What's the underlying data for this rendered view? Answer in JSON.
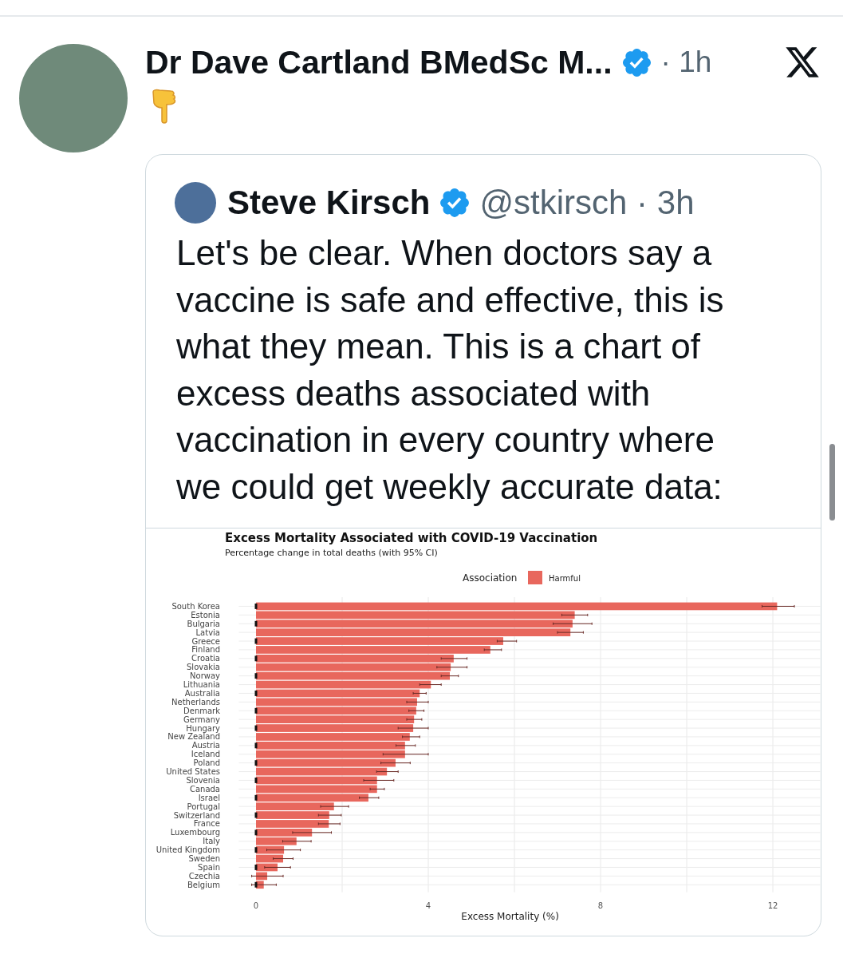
{
  "post": {
    "author": "Dr Dave Cartland BMedSc M...",
    "verified": true,
    "time": "· 1h"
  },
  "quoted_post": {
    "author": "Steve Kirsch",
    "verified": true,
    "handle": "@stkirsch",
    "time": "· 3h",
    "text": "Let's be clear. When doctors say a vaccine is safe and effective, this is what they mean. This is a chart of excess deaths associated with vaccination in every country where we could get weekly accurate data:",
    "chart_data": {
      "type": "bar",
      "orientation": "horizontal",
      "title": "Excess Mortality Associated with COVID-19 Vaccination",
      "subtitle": "Percentage change in total deaths (with 95% CI)",
      "legend_title": "Association",
      "xlabel": "Excess Mortality (%)",
      "categories": [
        "South Korea",
        "Estonia",
        "Bulgaria",
        "Latvia",
        "Greece",
        "Finland",
        "Croatia",
        "Slovakia",
        "Norway",
        "Lithuania",
        "Australia",
        "Netherlands",
        "Denmark",
        "Germany",
        "Hungary",
        "New Zealand",
        "Austria",
        "Iceland",
        "Poland",
        "United States",
        "Slovenia",
        "Canada",
        "Israel",
        "Portugal",
        "Switzerland",
        "France",
        "Luxembourg",
        "Italy",
        "United Kingdom",
        "Sweden",
        "Spain",
        "Czechia",
        "Belgium"
      ],
      "series": [
        {
          "name": "Harmful",
          "color": "#e8675d",
          "values": [
            12.1,
            7.4,
            7.35,
            7.3,
            5.74,
            5.44,
            4.59,
            4.52,
            4.5,
            4.06,
            3.8,
            3.74,
            3.72,
            3.67,
            3.65,
            3.57,
            3.46,
            3.46,
            3.24,
            3.04,
            2.81,
            2.81,
            2.61,
            1.81,
            1.7,
            1.69,
            1.3,
            0.94,
            0.65,
            0.63,
            0.5,
            0.26,
            0.18
          ],
          "errors": [
            [
              11.75,
              12.5
            ],
            [
              7.1,
              7.7
            ],
            [
              6.9,
              7.8
            ],
            [
              7.0,
              7.6
            ],
            [
              5.6,
              6.05
            ],
            [
              5.3,
              5.7
            ],
            [
              4.3,
              4.9
            ],
            [
              4.2,
              4.9
            ],
            [
              4.3,
              4.7
            ],
            [
              3.8,
              4.3
            ],
            [
              3.65,
              3.95
            ],
            [
              3.5,
              4.0
            ],
            [
              3.55,
              3.9
            ],
            [
              3.5,
              3.85
            ],
            [
              3.3,
              4.0
            ],
            [
              3.4,
              3.8
            ],
            [
              3.25,
              3.7
            ],
            [
              2.95,
              4.0
            ],
            [
              2.9,
              3.58
            ],
            [
              2.8,
              3.3
            ],
            [
              2.5,
              3.2
            ],
            [
              2.65,
              2.98
            ],
            [
              2.4,
              2.85
            ],
            [
              1.5,
              2.15
            ],
            [
              1.45,
              1.98
            ],
            [
              1.45,
              1.95
            ],
            [
              0.85,
              1.75
            ],
            [
              0.62,
              1.28
            ],
            [
              0.25,
              1.03
            ],
            [
              0.4,
              0.86
            ],
            [
              0.2,
              0.8
            ],
            [
              -0.1,
              0.63
            ],
            [
              -0.1,
              0.47
            ]
          ]
        }
      ],
      "grid": true,
      "xlim": [
        -0.4,
        13.1
      ],
      "xticks": [
        0,
        4,
        8,
        12
      ]
    }
  }
}
